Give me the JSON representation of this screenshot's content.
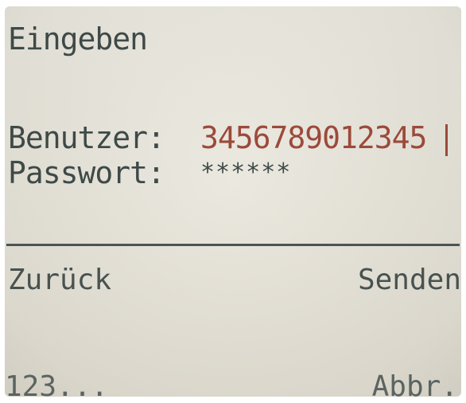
{
  "screen": {
    "title": "Eingeben"
  },
  "form": {
    "user_label": "Benutzer:",
    "user_value": "3456789012345",
    "password_label": "Passwort:",
    "password_value": "******"
  },
  "softkeys": {
    "left": "Zurück",
    "right": "Senden"
  },
  "status": {
    "input_mode": "123...",
    "cancel_label": "Abbr."
  }
}
